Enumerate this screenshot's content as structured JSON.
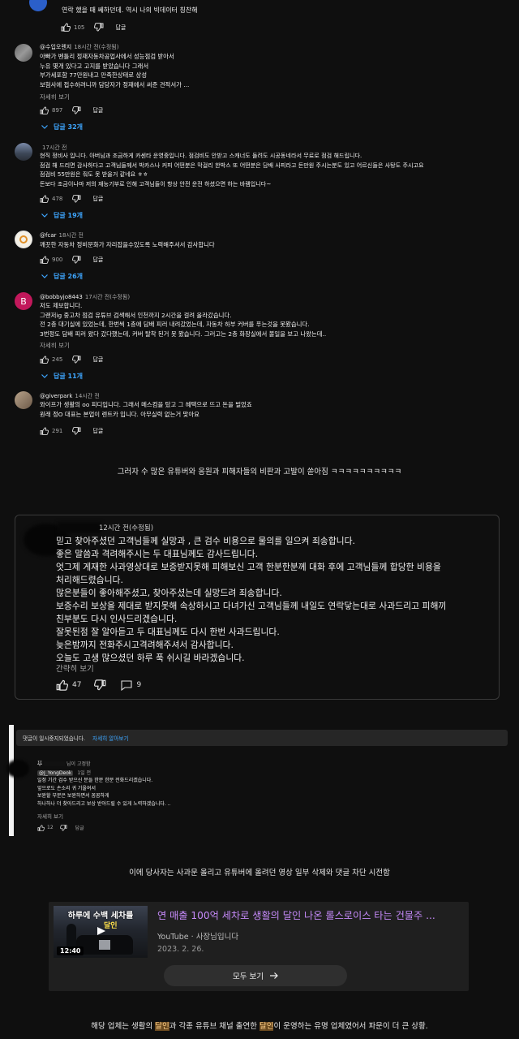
{
  "comments": [
    {
      "handle": "",
      "time": "",
      "lines": [
        "연락 했을 때 쎄하던데. 역시 나의 빅데이터 칭찬해"
      ],
      "more": "",
      "likes": "105",
      "reply_label": "답글",
      "replies": ""
    },
    {
      "handle": "@수입오렌지",
      "time": "18시간 전(수정됨)",
      "lines": [
        "아빠가 벤틀리 정재자동차공업사에서 성능점검 받아서",
        "누유 몇개 있다고 고지를 받았습니다 그래서",
        "부가세포함 77만원내고 만족한상태로 상성",
        "보험사에 접수하려니까 담당자가 정재에서 써준 견적서가 ..."
      ],
      "more": "자세히 보기",
      "likes": "897",
      "reply_label": "답글",
      "replies": "답글 32개"
    },
    {
      "handle": "",
      "time": "17시간 전",
      "lines": [
        "현직 정비사 입니다. 아버님과 조금하게 카센타 운영중입니다. 점검비도 안받고 스캐너도 돌려도 시공동네라서 무료로 점검 해드립니다.",
        "점검 해 드리면 감사하다고 고객님들께서 박카스나 커피 어떤분은 막걸리 한박스 또 어떤분은 담배 사피라고 돈만원 주시는분도 있고 어르신들은 사탕도 주시고요",
        "점검비 55만원은 줘도 못 받을거 같네요 ㅎㅎ",
        "돈보다 조금이나마 저의 재능기부로 인해 고객님들이 항상 안전 운전 하셨으면 하는 바램입니다~"
      ],
      "more": "",
      "likes": "478",
      "reply_label": "답글",
      "replies": "답글 19개"
    },
    {
      "handle": "@fcar",
      "time": "18시간 전",
      "lines": [
        "깨끗한 자동차 정비문화가 자리잡을수있도록 노력해주셔서 감사합니다"
      ],
      "more": "",
      "likes": "900",
      "reply_label": "답글",
      "replies": "답글 26개"
    },
    {
      "handle": "@bobbyjo8443",
      "time": "17시간 전(수정됨)",
      "lines": [
        "저도 제보합니다.",
        "그랜저ig 중고차 점검 유튜브 검색해서 인천까지 2시간을 걸려 올라갔습니다.",
        "전 2층 대기실에 있었는데, 한번씩 1층에 담배 피러 내려갔었는데, 자동차 하부 커버를 푸는것을 못봤습니다.",
        "3번정도 담배 피러 왔다 갔다했는데, 커버 탈착 된거 못 봤습니다. 그러고는 2층 화장실에서 볼일을 보고 나왔는데.."
      ],
      "more": "자세히 보기",
      "likes": "245",
      "reply_label": "답글",
      "replies": "답글 11개"
    },
    {
      "handle": "@giverpark",
      "time": "14시간 전",
      "lines": [
        "와이프가 생활의 oo 피디입니다. 그래서 메스컴을 탔고 그 혜택으로 뜨고 돈을 벌었죠",
        "원래 정O 대표는 본업이 렌트카 입니다. 아무실력 없는거 맞아요"
      ],
      "more": "",
      "likes": "291",
      "reply_label": "답글",
      "replies": ""
    }
  ],
  "caption1": "그러자 수 많은 유튜버와 응원과 피해자들의 비판과 고발이 쏟아짐 ㅋㅋㅋㅋㅋㅋㅋㅋㅋㅋ",
  "big_comment": {
    "time": "12시간 전(수정됨)",
    "lines": [
      "믿고 찾아주셨던 고객님들께 실망과 , 큰 검수 비용으로 물의를 일으켜 죄송합니다.",
      "좋은 말씀과 격려해주시는 두 대표님께도 감사드립니다.",
      "엇그제 게재한 사과영상대로 보증받지못해 피해보신 고객 한분한분께 대화 후에 고객님들께 합당한 비용을",
      "처리해드렸습니다.",
      "많은분들이 좋아해주셨고, 찾아주셨는데 실망드려 죄송합니다.",
      "보증수리 보상을 제대로 받지못해 속상하시고 다녀가신 고객님들께 내일도 연락닿는대로 사과드리고 피해끼",
      "친부분도 다시 인사드리겠습니다.",
      "잘못된점 잘 알아듣고 두 대표님께도 다시 한번 사과드립니다.",
      "늦은밤까지 전화주시고격려해주셔서 감사합니다.",
      "오늘도 고생 많으셨던 하루 푹 쉬시길 바라겠습니다."
    ],
    "less": "간략히 보기",
    "likes": "47",
    "replies_count": "9"
  },
  "paused": {
    "text": "댓글이 일시중지되었습니다.",
    "link": "자세히 알아보기"
  },
  "pinned": {
    "pin_text": "님이 고정함",
    "handle": "@J_YongDeok",
    "time": "1일 전",
    "lines": [
      "일정 기간 검수 받으신 분들 한분 한분 전화드리겠습니다.",
      "앞으로도 손소리 귀 기울여서",
      "보완할 부분은 보완하면서 꼼꼼하게",
      "하나하나 더 찾아드리고 보상 받아드릴 수 있게 노력하겠습니다. .."
    ],
    "more": "자세히 보기",
    "likes": "12",
    "reply_label": "답글"
  },
  "caption2": "이에 당사자는 사과문 올리고 유튜버에 올려던 영상 일부 삭제와 댓글 차단 시전함",
  "video": {
    "title": "연 매출 100억 세차로 생활의 달인 나온 롤스로이스 타는 건물주 ...",
    "channel": "YouTube · 사장님입니다",
    "date": "2023. 2. 26.",
    "duration": "12:40",
    "thumb_text_1": "하루에 수백 세차를",
    "thumb_text_2": "달인",
    "more_button": "모두 보기"
  },
  "caption3": {
    "part1": "해당 업체는 생활의 ",
    "hl1": "달인",
    "part2": "과 각종 유튜브 채널 출연한 ",
    "hl2": "달인",
    "part3": "이 운영하는 유명 업체였어서 파문이 더 큰 상황."
  },
  "icons": [
    "thumb-up-icon",
    "thumb-down-icon",
    "chevron-down-icon",
    "arrow-right-icon",
    "pin-icon"
  ],
  "colors": {
    "background": "#0f0f0f",
    "link": "#3ea6ff",
    "highlight": "#6b4a1f"
  }
}
